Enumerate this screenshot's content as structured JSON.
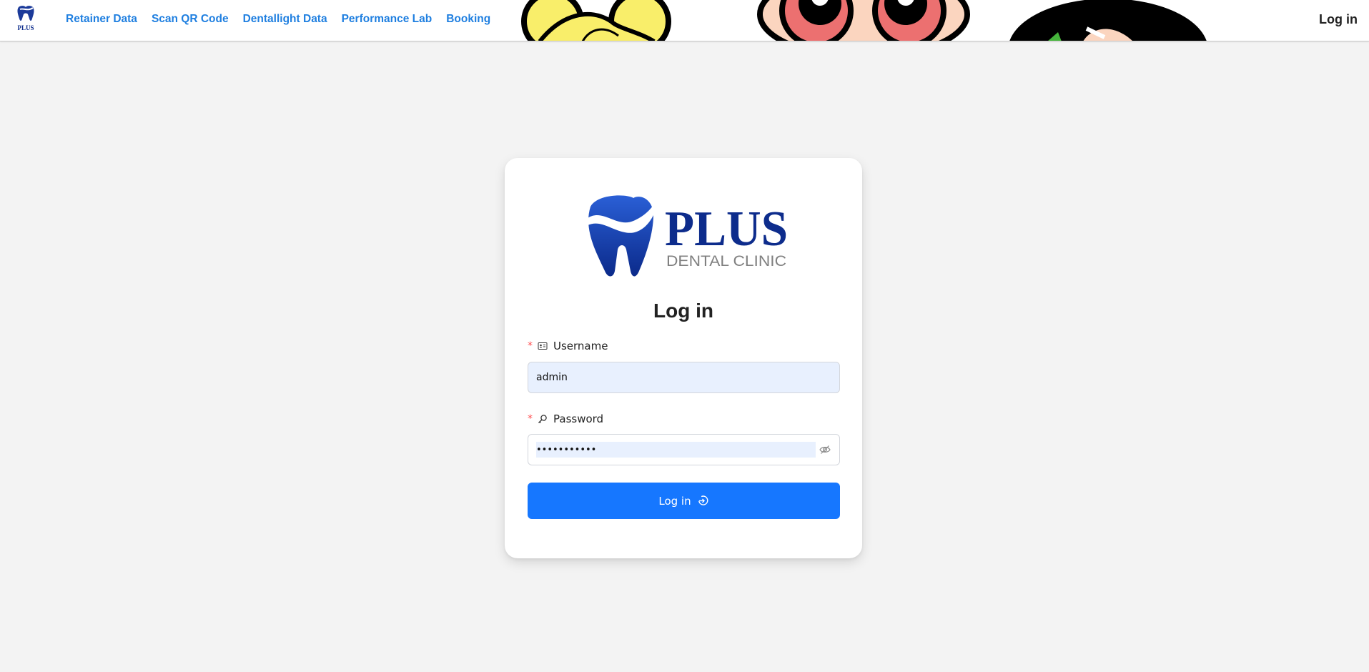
{
  "header": {
    "logo_text": "PLUS",
    "nav": [
      {
        "label": "Retainer Data"
      },
      {
        "label": "Scan QR Code"
      },
      {
        "label": "Dentallight Data"
      },
      {
        "label": "Performance Lab"
      },
      {
        "label": "Booking"
      }
    ],
    "login_label": "Log in"
  },
  "brand": {
    "name": "PLUS",
    "subtitle": "DENTAL CLINIC"
  },
  "form": {
    "title": "Log in",
    "username_label": "Username",
    "username_value": "admin",
    "password_label": "Password",
    "password_masked": "•••••••••••",
    "submit_label": "Log in"
  },
  "colors": {
    "primary": "#1677ff",
    "nav_link": "#1f7fe0",
    "brand_blue": "#0d2c8c",
    "brand_gray": "#808080",
    "required": "#ff4d4f",
    "autofill_bg": "#e8f0fe"
  },
  "icons": {
    "username": "id-card-icon",
    "password": "key-icon",
    "toggle": "eye-invisible-icon",
    "submit": "login-icon"
  }
}
